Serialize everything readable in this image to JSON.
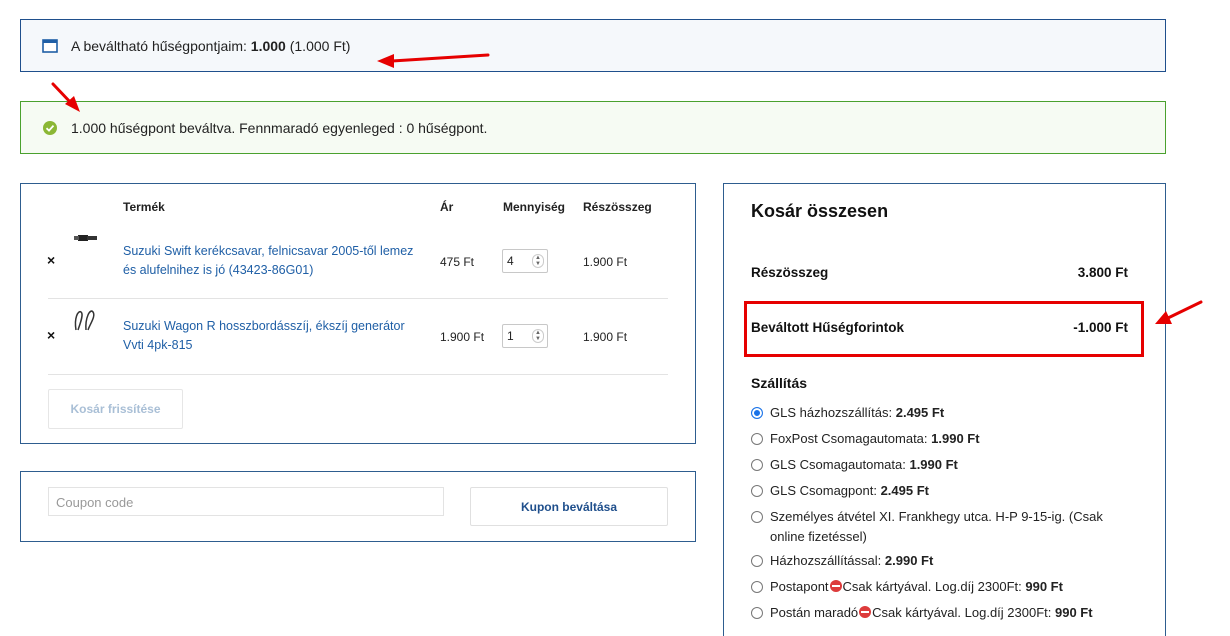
{
  "notices": {
    "info_prefix": "A beváltható hűségpontjaim: ",
    "info_points": "1.000",
    "info_suffix": " (1.000 Ft)",
    "success_text": "1.000 hűségpont beváltva. Fennmaradó egyenleged : 0 hűségpont."
  },
  "cart": {
    "headers": {
      "product": "Termék",
      "price": "Ár",
      "quantity": "Mennyiség",
      "subtotal": "Részösszeg"
    },
    "items": [
      {
        "remove": "×",
        "name": "Suzuki Swift kerékcsavar, felnicsavar 2005-től lemez és alufelnihez is jó (43423-86G01)",
        "price": "475 Ft",
        "quantity": "4",
        "subtotal": "1.900 Ft"
      },
      {
        "remove": "×",
        "name": "Suzuki Wagon R hosszbordásszíj, ékszíj generátor Vvti 4pk-815",
        "price": "1.900 Ft",
        "quantity": "1",
        "subtotal": "1.900 Ft"
      }
    ],
    "update_button": "Kosár frissítése"
  },
  "coupon": {
    "placeholder": "Coupon code",
    "button": "Kupon beváltása"
  },
  "totals": {
    "title": "Kosár összesen",
    "subtotal_label": "Részösszeg",
    "subtotal_value": "3.800 Ft",
    "loyalty_label": "Beváltott Hűségforintok",
    "loyalty_value": "-1.000 Ft",
    "shipping_title": "Szállítás",
    "shipping_options": [
      {
        "label": "GLS házhozszállítás: ",
        "price": "2.495 Ft",
        "selected": true
      },
      {
        "label": "FoxPost Csomagautomata: ",
        "price": "1.990 Ft",
        "selected": false
      },
      {
        "label": "GLS Csomagautomata: ",
        "price": "1.990 Ft",
        "selected": false
      },
      {
        "label": "GLS Csomagpont: ",
        "price": "2.495 Ft",
        "selected": false
      },
      {
        "label": "Személyes átvétel XI. Frankhegy utca. H-P 9-15-ig. (Csak online fizetéssel)",
        "price": "",
        "selected": false
      },
      {
        "label": "Házhozszállítással: ",
        "price": "2.990 Ft",
        "selected": false
      },
      {
        "label_a": "Postapont",
        "label_b": "Csak kártyával. Log.díj 2300Ft: ",
        "price": "990 Ft",
        "selected": false
      },
      {
        "label_a": "Postán maradó",
        "label_b": "Csak kártyával. Log.díj 2300Ft: ",
        "price": "990 Ft",
        "selected": false
      }
    ]
  },
  "colors": {
    "accent_blue": "#1f4f8c",
    "success_green": "#4aa12e",
    "annotation_red": "#e60000",
    "link_blue": "#1f5fa6"
  }
}
